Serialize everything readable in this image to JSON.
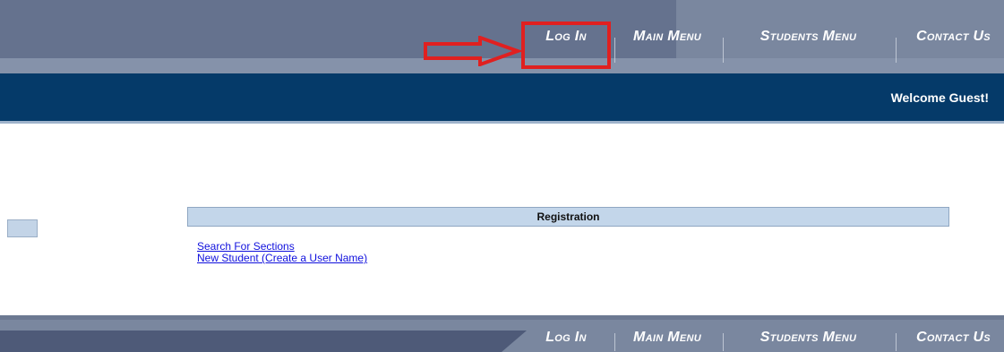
{
  "nav": {
    "items": [
      {
        "label": "Log In"
      },
      {
        "label": "Main Menu"
      },
      {
        "label": "Students Menu"
      },
      {
        "label": "Contact Us"
      }
    ]
  },
  "welcome": {
    "text": "Welcome Guest!"
  },
  "registration": {
    "title": "Registration",
    "links": [
      {
        "label": "Search For Sections"
      },
      {
        "label": "New Student (Create a User Name)"
      }
    ]
  },
  "colors": {
    "nav_bg": "#7a879f",
    "welcome_bg": "#053a69",
    "highlight": "#e02020",
    "link": "#1010dd"
  }
}
